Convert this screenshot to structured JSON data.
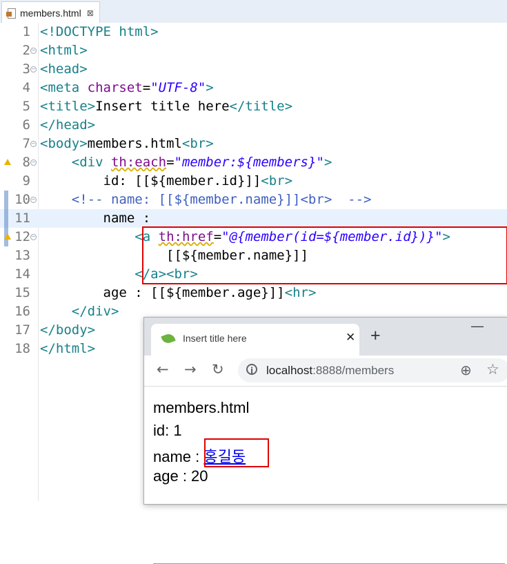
{
  "editor_tab": {
    "title": "members.html",
    "close": "⊠"
  },
  "code_lines": [
    {
      "n": "1"
    },
    {
      "n": "2"
    },
    {
      "n": "3"
    },
    {
      "n": "4"
    },
    {
      "n": "5"
    },
    {
      "n": "6"
    },
    {
      "n": "7"
    },
    {
      "n": "8"
    },
    {
      "n": "9"
    },
    {
      "n": "10"
    },
    {
      "n": "11"
    },
    {
      "n": "12"
    },
    {
      "n": "13"
    },
    {
      "n": "14"
    },
    {
      "n": "15"
    },
    {
      "n": "16"
    },
    {
      "n": "17"
    },
    {
      "n": "18"
    }
  ],
  "code": {
    "l1": "<!DOCTYPE html>",
    "l2": "<html>",
    "l3": "<head>",
    "l4_tag": "<meta",
    "l4_attr": "charset",
    "l4_eq": "=",
    "l4_str": "\"UTF-8\"",
    "l4_end": ">",
    "l5_open": "<title>",
    "l5_text": "Insert title here",
    "l5_close": "</title>",
    "l6": "</head>",
    "l7_tag": "<body>",
    "l7_text": "members.html",
    "l7_br": "<br>",
    "l8_tag": "<div",
    "l8_attr": "th:each",
    "l8_eq": "=",
    "l8_str": "\"member:${members}\"",
    "l8_end": ">",
    "l9_text": "id: [[${member.id}]]",
    "l9_br": "<br>",
    "l10": "<!-- name: [[${member.name}]]<br>  -->",
    "l11": "name :",
    "l12_tag": "<a",
    "l12_attr": "th:href",
    "l12_eq": "=",
    "l12_str": "\"@{member(id=${member.id})}\"",
    "l12_end": ">",
    "l13": "[[${member.name}]]",
    "l14": "</a><br>",
    "l15_text": "age : [[${member.age}]]",
    "l15_hr": "<hr>",
    "l16": "</div>",
    "l17": "</body>",
    "l18": "</html>"
  },
  "browser": {
    "tab_title": "Insert title here",
    "tab_close": "✕",
    "new_tab": "+",
    "minimize": "—",
    "back": "←",
    "forward": "→",
    "reload": "↻",
    "info": "i",
    "url_host": "localhost",
    "url_path": ":8888/members",
    "zoom": "⊕",
    "star": "☆",
    "page": {
      "title_line": "members.html",
      "id_line": "id: 1",
      "name_label": "name : ",
      "name_link": "홍길동",
      "age_line": "age : 20"
    }
  }
}
